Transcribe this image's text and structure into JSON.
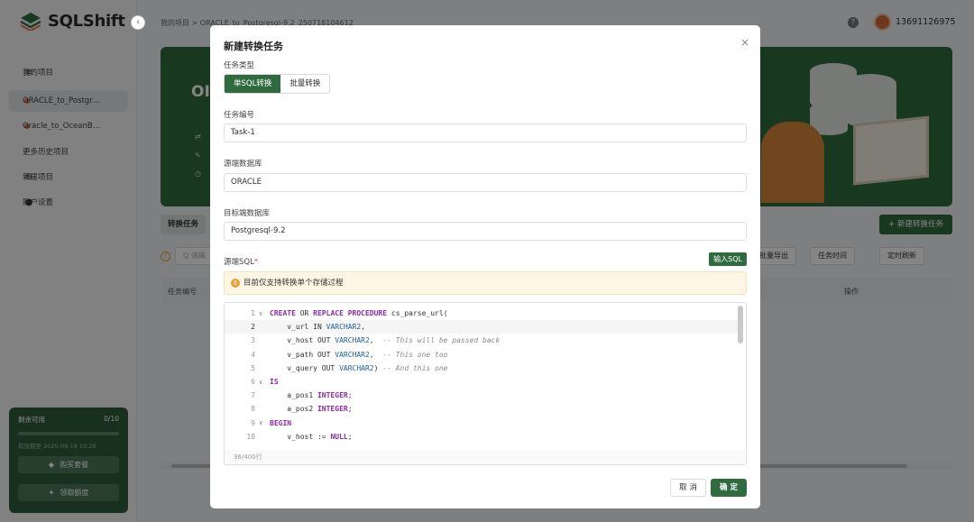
{
  "app": {
    "logo_text": "SQLShift",
    "collapse_icon": "‹"
  },
  "breadcrumb": "我的项目 > ORACLE_to_Postgresql-9.2_250718104612",
  "user": {
    "name": "13691126975",
    "help_icon": "?"
  },
  "sidebar": {
    "items": [
      {
        "label": "我的项目",
        "icon": "database-icon"
      },
      {
        "label": "ORACLE_to_Postgr…",
        "icon": "dot-icon"
      },
      {
        "label": "Oracle_to_OceanB…",
        "icon": "dot-icon"
      },
      {
        "label": "更多历史项目",
        "icon": "more-icon"
      },
      {
        "label": "新建项目",
        "icon": "plus-icon"
      },
      {
        "label": "账户设置",
        "icon": "user-icon"
      }
    ],
    "quota": {
      "label": "剩余可用",
      "value": "0/10",
      "expiry": "有效期至 2025-08-18 10:26",
      "buy_label": "购买套餐",
      "claim_label": "领取额度"
    }
  },
  "banner": {
    "title": "OI"
  },
  "main": {
    "tab_label": "转换任务",
    "new_task_label": "+ 新建转换任务",
    "search_placeholder": "Q 请输",
    "filters": [
      "批量导出",
      "任务时间",
      "定时刷新"
    ],
    "table_headers": [
      "任务编号",
      "操作"
    ]
  },
  "modal": {
    "title": "新建转换任务",
    "close_icon": "×",
    "task_type_label": "任务类型",
    "task_types": [
      "单SQL转换",
      "批量转换"
    ],
    "task_id_label": "任务编号",
    "task_id_value": "Task-1",
    "source_db_label": "源端数据库",
    "source_db_value": "ORACLE",
    "target_db_label": "目标端数据库",
    "target_db_value": "Postgresql-9.2",
    "source_sql_label": "源端SQL",
    "required_mark": "*",
    "input_sql_label": "输入SQL",
    "tip_text": "目前仅支持转换单个存储过程",
    "line_count": "36/400行",
    "cancel_label": "取 消",
    "ok_label": "确 定",
    "code_lines": [
      {
        "n": "1",
        "fold": true,
        "cur": false,
        "segs": [
          {
            "t": "CREATE",
            "c": "kw"
          },
          {
            "t": " OR ",
            "c": ""
          },
          {
            "t": "REPLACE",
            "c": "kw"
          },
          {
            "t": " ",
            "c": ""
          },
          {
            "t": "PROCEDURE",
            "c": "kw"
          },
          {
            "t": " cs_parse_url(",
            "c": ""
          }
        ]
      },
      {
        "n": "2",
        "fold": false,
        "cur": true,
        "segs": [
          {
            "t": "    v_url IN ",
            "c": ""
          },
          {
            "t": "VARCHAR2",
            "c": "ty"
          },
          {
            "t": ",",
            "c": ""
          }
        ]
      },
      {
        "n": "3",
        "fold": false,
        "cur": false,
        "segs": [
          {
            "t": "    v_host OUT ",
            "c": ""
          },
          {
            "t": "VARCHAR2",
            "c": "ty"
          },
          {
            "t": ",  ",
            "c": ""
          },
          {
            "t": "-- This will be passed back",
            "c": "cm"
          }
        ]
      },
      {
        "n": "4",
        "fold": false,
        "cur": false,
        "segs": [
          {
            "t": "    v_path OUT ",
            "c": ""
          },
          {
            "t": "VARCHAR2",
            "c": "ty"
          },
          {
            "t": ",  ",
            "c": ""
          },
          {
            "t": "-- This one too",
            "c": "cm"
          }
        ]
      },
      {
        "n": "5",
        "fold": false,
        "cur": false,
        "segs": [
          {
            "t": "    v_query OUT ",
            "c": ""
          },
          {
            "t": "VARCHAR2",
            "c": "ty"
          },
          {
            "t": ") ",
            "c": ""
          },
          {
            "t": "-- And this one",
            "c": "cm"
          }
        ]
      },
      {
        "n": "6",
        "fold": true,
        "cur": false,
        "segs": [
          {
            "t": "IS",
            "c": "kw"
          }
        ]
      },
      {
        "n": "7",
        "fold": false,
        "cur": false,
        "segs": [
          {
            "t": "    a_pos1 ",
            "c": ""
          },
          {
            "t": "INTEGER",
            "c": "kw"
          },
          {
            "t": ";",
            "c": ""
          }
        ]
      },
      {
        "n": "8",
        "fold": false,
        "cur": false,
        "segs": [
          {
            "t": "    a_pos2 ",
            "c": ""
          },
          {
            "t": "INTEGER",
            "c": "kw"
          },
          {
            "t": ";",
            "c": ""
          }
        ]
      },
      {
        "n": "9",
        "fold": true,
        "cur": false,
        "segs": [
          {
            "t": "BEGIN",
            "c": "kw"
          }
        ]
      },
      {
        "n": "10",
        "fold": false,
        "cur": false,
        "segs": [
          {
            "t": "    v_host := ",
            "c": ""
          },
          {
            "t": "NULL",
            "c": "kw"
          },
          {
            "t": ";",
            "c": ""
          }
        ]
      }
    ]
  },
  "colors": {
    "brand": "#2f6b3f",
    "warning": "#e6a23c",
    "keyword": "#8b2aa8"
  }
}
